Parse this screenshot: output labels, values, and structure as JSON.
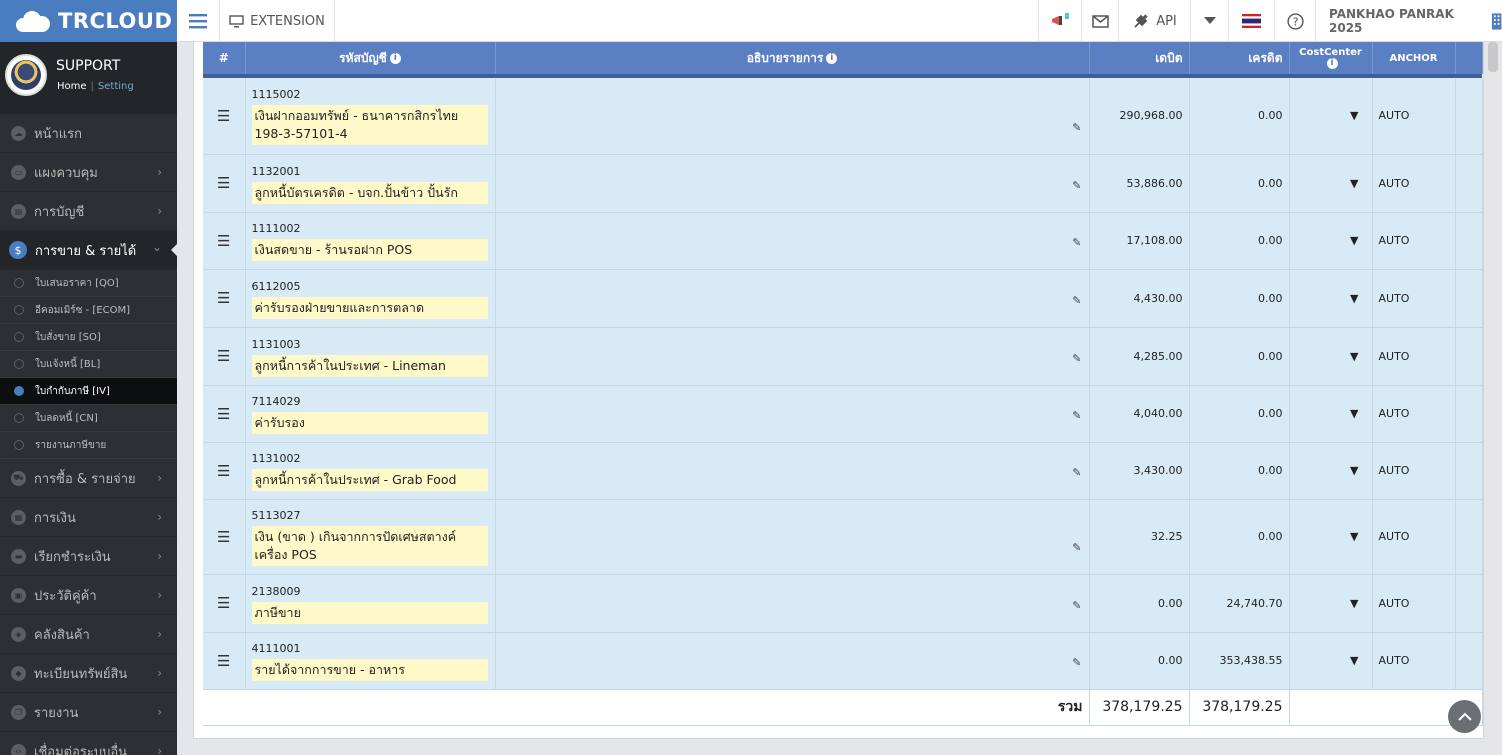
{
  "app": {
    "brand_light": "TR",
    "brand_bold": "CLOUD"
  },
  "topbar": {
    "extension_label": "EXTENSION",
    "api_label": "API",
    "company_name": "PANKHAO PANRAK 2025"
  },
  "profile": {
    "name": "SUPPORT",
    "home_link": "Home",
    "sep": "|",
    "setting_link": "Setting"
  },
  "sidebar": {
    "items": [
      {
        "label": "หน้าแรก",
        "icon": "cloud-icon",
        "chev": ""
      },
      {
        "label": "แผงควบคุม",
        "icon": "monitor-icon",
        "chev": "›"
      },
      {
        "label": "การบัญชี",
        "icon": "book-icon",
        "chev": "›"
      },
      {
        "label": "การขาย & รายได้",
        "icon": "dollar-icon",
        "chev": "⌄"
      }
    ],
    "subitems": [
      {
        "label": "ใบเสนอราคา [QO]"
      },
      {
        "label": "อีคอมเมิร์ซ - [ECOM]"
      },
      {
        "label": "ใบสั่งขาย [SO]"
      },
      {
        "label": "ใบแจ้งหนี้ [BL]"
      },
      {
        "label": "ใบกำกับภาษี [IV]"
      },
      {
        "label": "ใบลดหนี้ [CN]"
      },
      {
        "label": "รายงานภาษีขาย"
      }
    ],
    "items2": [
      {
        "label": "การซื้อ & รายจ่าย",
        "icon": "cart-icon",
        "chev": "›"
      },
      {
        "label": "การเงิน",
        "icon": "calendar-icon",
        "chev": "›"
      },
      {
        "label": "เรียกชำระเงิน",
        "icon": "card-icon",
        "chev": "›"
      },
      {
        "label": "ประวัติคู่ค้า",
        "icon": "contact-icon",
        "chev": "›"
      },
      {
        "label": "คลังสินค้า",
        "icon": "cubes-icon",
        "chev": "›"
      },
      {
        "label": "ทะเบียนทรัพย์สิน",
        "icon": "diamond-icon",
        "chev": "›"
      },
      {
        "label": "รายงาน",
        "icon": "copy-icon",
        "chev": "›"
      },
      {
        "label": "เชื่อมต่อระบบอื่น",
        "icon": "code-icon",
        "chev": "›"
      }
    ]
  },
  "table": {
    "headers": {
      "num": "#",
      "account": "รหัสบัญชี",
      "desc": "อธิบายรายการ",
      "debit": "เดบิต",
      "credit": "เครดิต",
      "cost_center": "CostCenter",
      "anchor": "ANCHOR"
    },
    "rows": [
      {
        "code": "1115002",
        "name": "เงินฝากออมทรัพย์ - ธนาคารกสิกรไทย 198-3-57101-4",
        "debit": "290,968.00",
        "credit": "0.00",
        "anchor": "AUTO"
      },
      {
        "code": "1132001",
        "name": "ลูกหนี้บัตรเครดิต - บจก.ปั้นข้าว ปั้นรัก",
        "debit": "53,886.00",
        "credit": "0.00",
        "anchor": "AUTO"
      },
      {
        "code": "1111002",
        "name": "เงินสดขาย - ร้านรอฝาก POS",
        "debit": "17,108.00",
        "credit": "0.00",
        "anchor": "AUTO"
      },
      {
        "code": "6112005",
        "name": "ค่ารับรองฝ่ายขายและการตลาด",
        "debit": "4,430.00",
        "credit": "0.00",
        "anchor": "AUTO"
      },
      {
        "code": "1131003",
        "name": "ลูกหนี้การค้าในประเทศ - Lineman",
        "debit": "4,285.00",
        "credit": "0.00",
        "anchor": "AUTO"
      },
      {
        "code": "7114029",
        "name": "ค่ารับรอง",
        "debit": "4,040.00",
        "credit": "0.00",
        "anchor": "AUTO"
      },
      {
        "code": "1131002",
        "name": "ลูกหนี้การค้าในประเทศ - Grab Food",
        "debit": "3,430.00",
        "credit": "0.00",
        "anchor": "AUTO"
      },
      {
        "code": "5113027",
        "name": "เงิน (ขาด ) เกินจากการปัดเศษสตางค์เครื่อง POS",
        "debit": "32.25",
        "credit": "0.00",
        "anchor": "AUTO"
      },
      {
        "code": "2138009",
        "name": "ภาษีขาย",
        "debit": "0.00",
        "credit": "24,740.70",
        "anchor": "AUTO"
      },
      {
        "code": "4111001",
        "name": "รายได้จากการขาย - อาหาร",
        "debit": "0.00",
        "credit": "353,438.55",
        "anchor": "AUTO"
      }
    ],
    "total_label": "รวม",
    "total_debit": "378,179.25",
    "total_credit": "378,179.25"
  },
  "colors": {
    "brand": "#4a7cc0",
    "header": "#5b7fc3",
    "row_bg": "#d8eaf5",
    "desc_bg": "#fff9c9"
  }
}
